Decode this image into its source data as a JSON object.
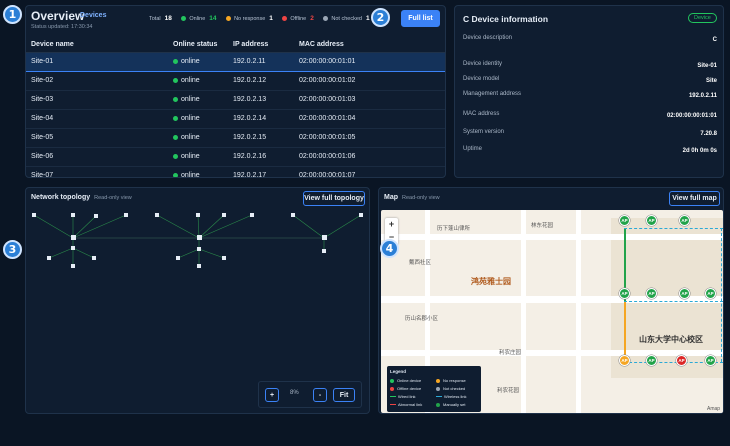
{
  "markers": [
    "1",
    "2",
    "3",
    "4"
  ],
  "overview": {
    "title": "Overview",
    "subtitle": "Devices",
    "status_updated": "Status updated: 17:30:34",
    "counts": [
      {
        "label": "Total",
        "value": "18",
        "color": ""
      },
      {
        "label": "Online",
        "value": "14",
        "color": "#22c55e"
      },
      {
        "label": "No response",
        "value": "1",
        "color": "#f5a623"
      },
      {
        "label": "Offline",
        "value": "2",
        "color": "#ef4444"
      },
      {
        "label": "Not checked",
        "value": "1",
        "color": "#9aa6b5"
      }
    ],
    "full_list_label": "Full list",
    "columns": [
      "Device name",
      "Online status",
      "IP address",
      "MAC address"
    ],
    "rows": [
      [
        "Site-01",
        "online",
        "192.0.2.11",
        "02:00:00:00:01:01"
      ],
      [
        "Site-02",
        "online",
        "192.0.2.12",
        "02:00:00:00:01:02"
      ],
      [
        "Site-03",
        "online",
        "192.0.2.13",
        "02:00:00:00:01:03"
      ],
      [
        "Site-04",
        "online",
        "192.0.2.14",
        "02:00:00:00:01:04"
      ],
      [
        "Site-05",
        "online",
        "192.0.2.15",
        "02:00:00:00:01:05"
      ],
      [
        "Site-06",
        "online",
        "192.0.2.16",
        "02:00:00:00:01:06"
      ],
      [
        "Site-07",
        "online",
        "192.0.2.17",
        "02:00:00:00:01:07"
      ]
    ]
  },
  "info": {
    "title": "C Device information",
    "badge": "Device",
    "rows": [
      {
        "key": "Device description",
        "value": "C"
      },
      {
        "key": "Device identity",
        "value": "Site-01"
      },
      {
        "key": "Device model",
        "value": "Site"
      },
      {
        "key": "Management address",
        "value": "192.0.2.11"
      },
      {
        "key": "MAC address",
        "value": "02:00:00:00:01:01"
      },
      {
        "key": "System version",
        "value": "7.20.8"
      },
      {
        "key": "Uptime",
        "value": "2d 0h 0m 0s"
      }
    ]
  },
  "topology": {
    "title": "Network topology",
    "readonly": "Read-only view",
    "view_full_label": "View full topology",
    "zoom_in": "+",
    "zoom_level": "8%",
    "zoom_out": "-",
    "fit": "Fit"
  },
  "map": {
    "title": "Map",
    "readonly": "Read-only view",
    "view_full_label": "View full map",
    "zoom_in": "+",
    "zoom_out": "−",
    "labels": [
      "历下蓬山律所",
      "林东花园",
      "鸿苑雅士园",
      "山东大学中心校区",
      "戴西社区",
      "历山名郡小区",
      "利农庄园",
      "利农花园",
      "Amap"
    ],
    "legend": {
      "title": "Legend",
      "items": [
        "Online device",
        "No response",
        "Offline device",
        "Not checked",
        "Wired link",
        "Wireless link",
        "Abnormal link",
        "Manually set"
      ]
    }
  },
  "colors": {
    "accent": "#3b82f6",
    "online": "#22c55e",
    "no_response": "#f5a623",
    "offline": "#ef4444"
  }
}
